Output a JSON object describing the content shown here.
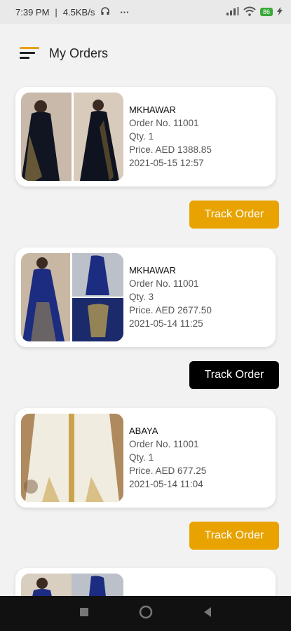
{
  "status": {
    "time": "7:39 PM",
    "speed": "4.5KB/s",
    "more": "···",
    "battery": "86"
  },
  "header": {
    "title": "My Orders"
  },
  "colors": {
    "accent": "#e8a300",
    "dark": "#000000"
  },
  "orders": [
    {
      "brand": "MKHAWAR",
      "order_no": "Order No. 11001",
      "qty": "Qty. 1",
      "price": "Price. AED 1388.85",
      "date": "2021-05-15 12:57",
      "button": "Track Order"
    },
    {
      "brand": "MKHAWAR",
      "order_no": "Order No. 11001",
      "qty": "Qty. 3",
      "price": "Price. AED 2677.50",
      "date": "2021-05-14 11:25",
      "button": "Track Order"
    },
    {
      "brand": "ABAYA",
      "order_no": "Order No. 11001",
      "qty": "Qty. 1",
      "price": "Price. AED 677.25",
      "date": "2021-05-14 11:04",
      "button": "Track Order"
    }
  ]
}
